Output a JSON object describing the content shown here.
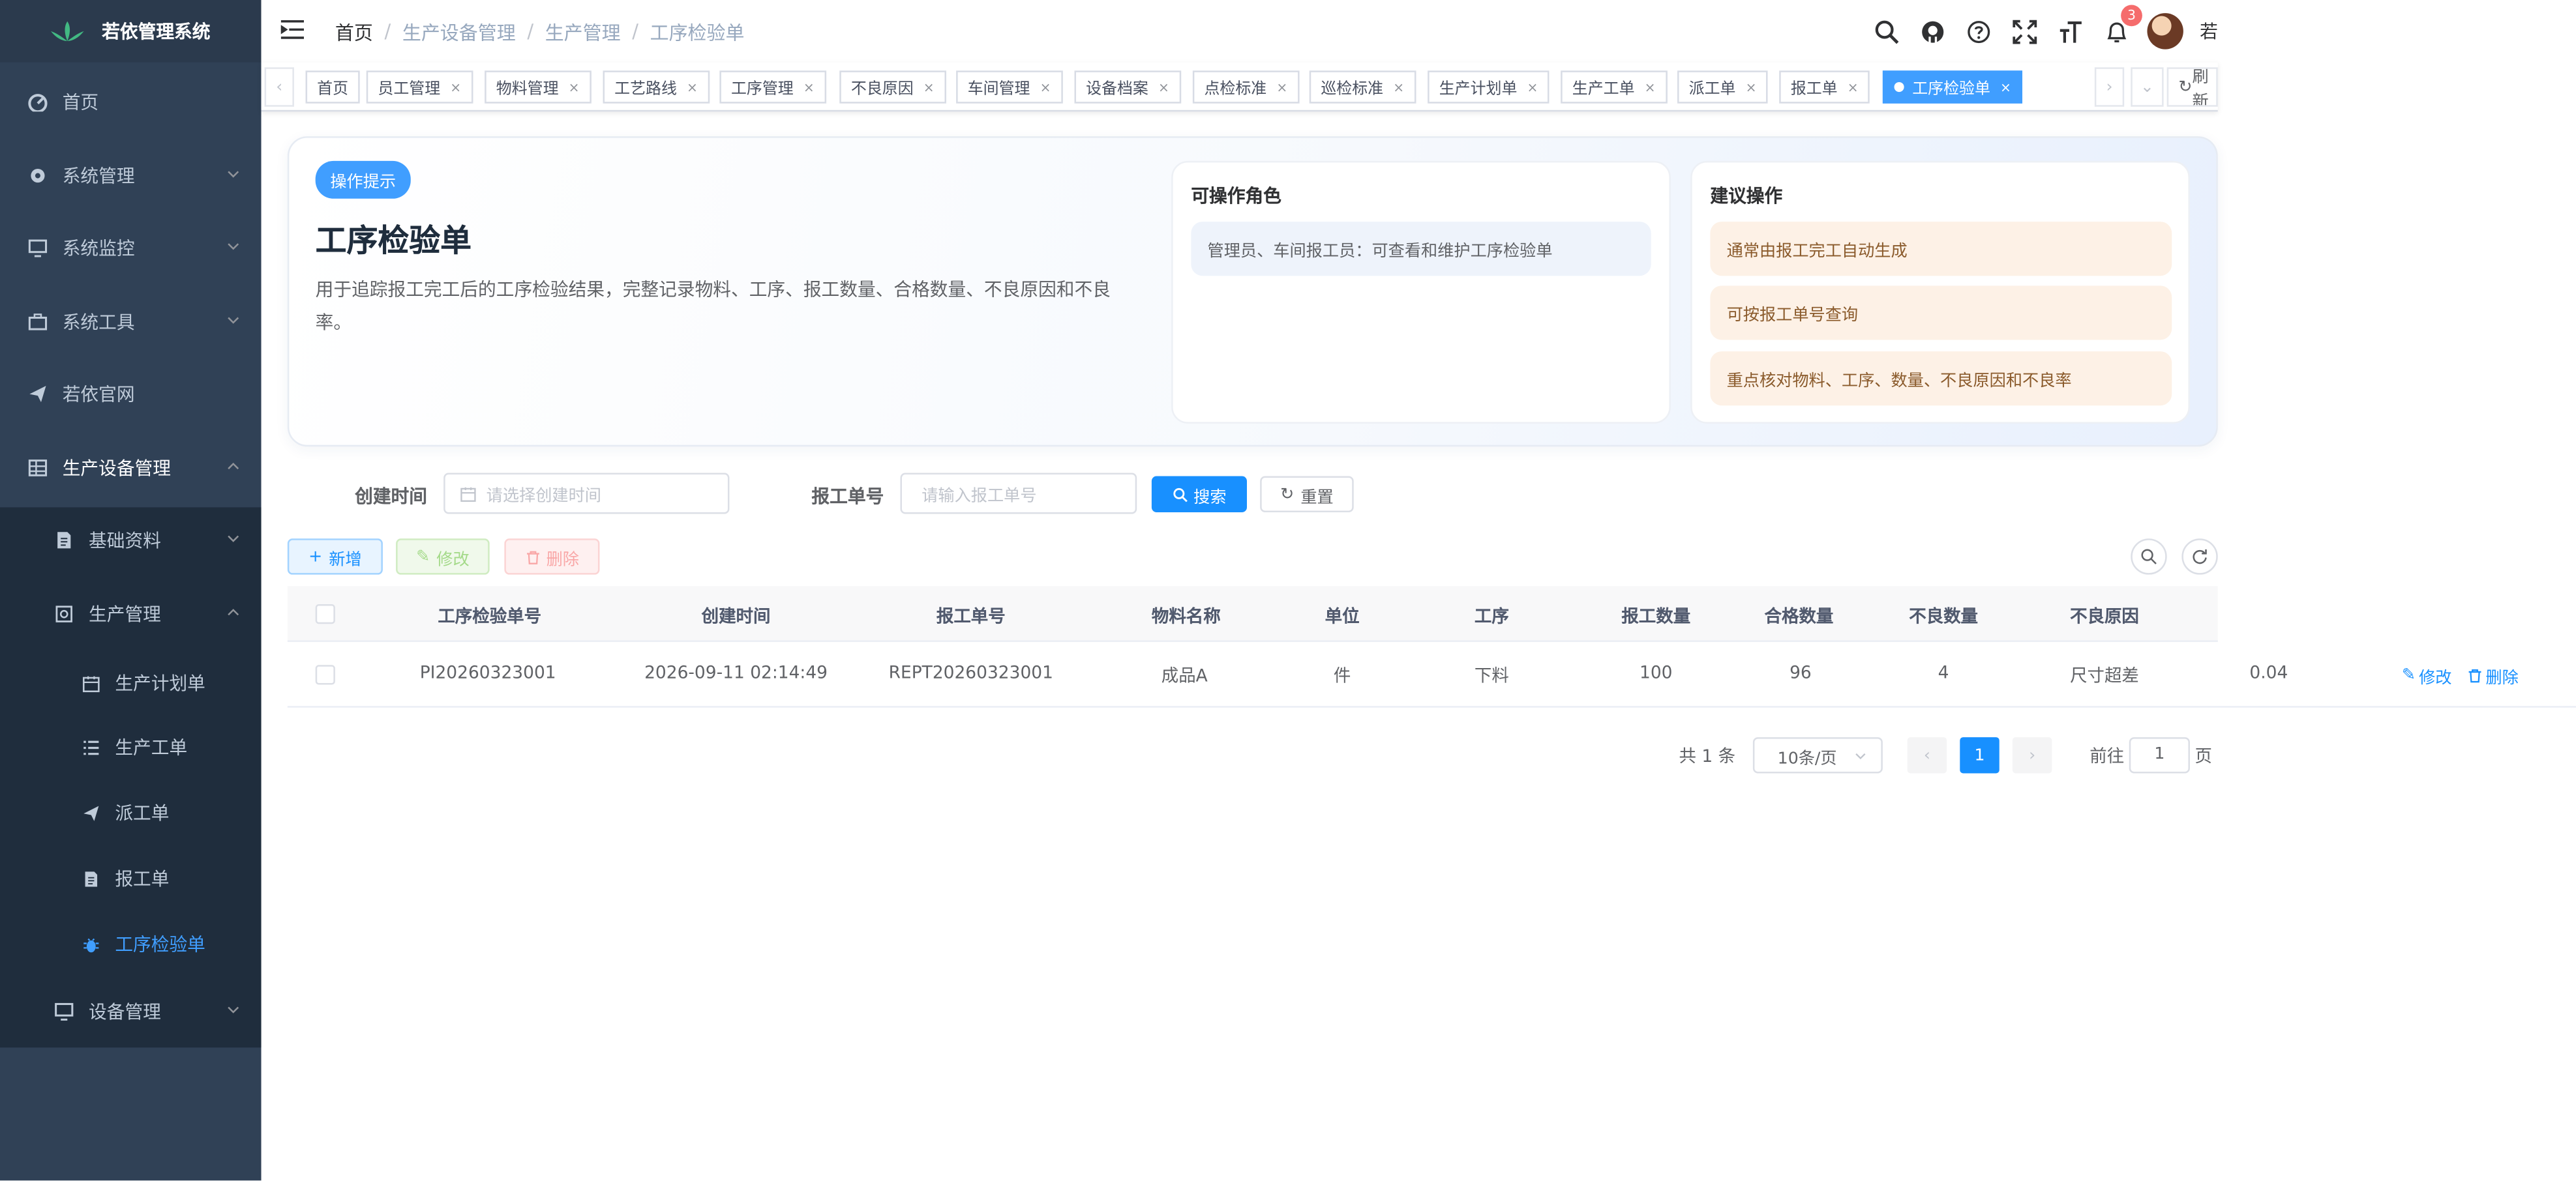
{
  "app": {
    "title": "若依管理系统"
  },
  "sidebar": {
    "items": [
      {
        "label": "首页",
        "icon": "dashboard-icon"
      },
      {
        "label": "系统管理",
        "icon": "gear-icon"
      },
      {
        "label": "系统监控",
        "icon": "monitor-icon"
      },
      {
        "label": "系统工具",
        "icon": "toolbox-icon"
      },
      {
        "label": "若依官网",
        "icon": "paper-plane-icon"
      },
      {
        "label": "生产设备管理",
        "icon": "table-icon"
      }
    ],
    "sub": [
      {
        "label": "基础资料"
      },
      {
        "label": "生产管理"
      }
    ],
    "leaf": [
      {
        "label": "生产计划单"
      },
      {
        "label": "生产工单"
      },
      {
        "label": "派工单"
      },
      {
        "label": "报工单"
      },
      {
        "label": "工序检验单"
      }
    ],
    "device": {
      "label": "设备管理"
    }
  },
  "navbar": {
    "breadcrumb": [
      "首页",
      "生产设备管理",
      "生产管理",
      "工序检验单"
    ],
    "notification_count": "3",
    "username": "若"
  },
  "tags": {
    "items": [
      "首页",
      "员工管理",
      "物料管理",
      "工艺路线",
      "工序管理",
      "不良原因",
      "车间管理",
      "设备档案",
      "点检标准",
      "巡检标准",
      "生产计划单",
      "生产工单",
      "派工单",
      "报工单",
      "工序检验单"
    ],
    "refresh_label": "刷新"
  },
  "hero": {
    "pill": "操作提示",
    "title": "工序检验单",
    "description": "用于追踪报工完工后的工序检验结果，完整记录物料、工序、报工数量、合格数量、不良原因和不良率。",
    "roles_title": "可操作角色",
    "roles_text": "管理员、车间报工员：可查看和维护工序检验单",
    "suggest_title": "建议操作",
    "suggestions": [
      "通常由报工完工自动生成",
      "可按报工单号查询",
      "重点核对物料、工序、数量、不良原因和不良率"
    ]
  },
  "search": {
    "created_label": "创建时间",
    "created_placeholder": "请选择创建时间",
    "report_label": "报工单号",
    "report_placeholder": "请输入报工单号",
    "search_btn": "搜索",
    "reset_btn": "重置"
  },
  "toolbar": {
    "add": "新增",
    "edit": "修改",
    "delete": "删除"
  },
  "table": {
    "headers": [
      "工序检验单号",
      "创建时间",
      "报工单号",
      "物料名称",
      "单位",
      "工序",
      "报工数量",
      "合格数量",
      "不良数量",
      "不良原因"
    ],
    "rows": [
      {
        "cells": [
          "PI20260323001",
          "2026-09-11 02:14:49",
          "REPT20260323001",
          "成品A",
          "件",
          "下料",
          "100",
          "96",
          "4",
          "尺寸超差",
          "0.04"
        ],
        "edit": "修改",
        "delete": "删除"
      }
    ]
  },
  "pagination": {
    "total": "共 1 条",
    "page_size": "10条/页",
    "current": "1",
    "goto_label": "前往",
    "goto_value": "1",
    "page_suffix": "页"
  },
  "colors": {
    "sidebar_bg": "#304156",
    "primary": "#1890ff",
    "active_menu": "#409eff"
  }
}
